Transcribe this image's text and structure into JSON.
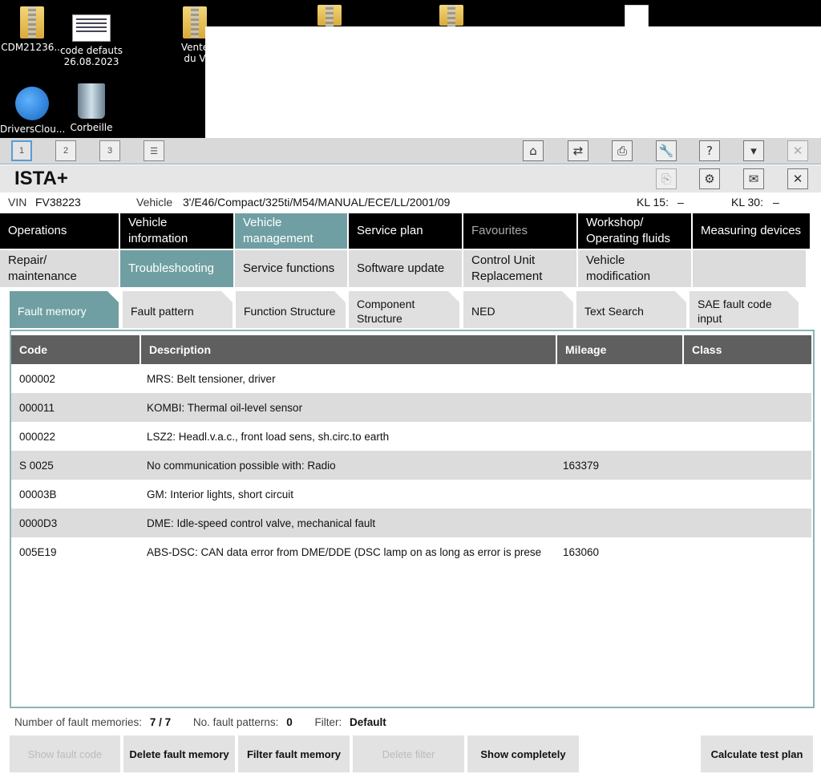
{
  "desktop": {
    "icons": [
      {
        "label": "CDM21236...",
        "icon": "zip-folder-icon"
      },
      {
        "label": "code defauts",
        "sub": "26.08.2023",
        "icon": "spreadsheet-icon"
      },
      {
        "label": "Vente",
        "sub": "du V",
        "icon": "zip-folder-icon"
      },
      {
        "label": "DriversClou...",
        "icon": "drivers-cloud-icon"
      },
      {
        "label": "Corbeille",
        "icon": "recycle-bin-icon"
      }
    ]
  },
  "toolbar": {
    "sessions": [
      "1",
      "2",
      "3"
    ],
    "icons": {
      "home": "⌂",
      "connect": "⇄",
      "print": "⎙",
      "wrench": "🔧",
      "help": "?",
      "hide": "▾",
      "close": "✕"
    }
  },
  "app": {
    "title": "ISTA+",
    "icons": {
      "doc": "⎘",
      "settings": "⚙",
      "mail": "✉",
      "close": "✕"
    }
  },
  "vehicle": {
    "vin_label": "VIN",
    "vin": "FV38223",
    "vehicle_label": "Vehicle",
    "vehicle": "3'/E46/Compact/325ti/M54/MANUAL/ECE/LL/2001/09",
    "kl15_label": "KL 15:",
    "kl15": "–",
    "kl30_label": "KL 30:",
    "kl30": "–"
  },
  "nav_main": [
    {
      "label": "Operations"
    },
    {
      "label": "Vehicle information"
    },
    {
      "label": "Vehicle management"
    },
    {
      "label": "Service plan"
    },
    {
      "label": "Favourites"
    },
    {
      "label": "Workshop/ Operating fluids"
    },
    {
      "label": "Measuring devices"
    }
  ],
  "nav_sub": [
    {
      "label": "Repair/ maintenance"
    },
    {
      "label": "Troubleshooting"
    },
    {
      "label": "Service functions"
    },
    {
      "label": "Software update"
    },
    {
      "label": "Control Unit Replacement"
    },
    {
      "label": "Vehicle modification"
    },
    {
      "label": ""
    }
  ],
  "tabs": [
    {
      "label": "Fault memory"
    },
    {
      "label": "Fault pattern"
    },
    {
      "label": "Function Structure"
    },
    {
      "label": "Component Structure"
    },
    {
      "label": "NED"
    },
    {
      "label": "Text Search"
    },
    {
      "label": "SAE fault code input"
    }
  ],
  "table": {
    "headers": [
      "Code",
      "Description",
      "Mileage",
      "Class"
    ],
    "rows": [
      {
        "code": "000002",
        "desc": "MRS: Belt tensioner, driver",
        "mileage": "",
        "class": ""
      },
      {
        "code": "000011",
        "desc": "KOMBI: Thermal oil-level sensor",
        "mileage": "",
        "class": ""
      },
      {
        "code": "000022",
        "desc": "LSZ2: Headl.v.a.c., front load sens, sh.circ.to earth",
        "mileage": "",
        "class": ""
      },
      {
        "code": "S 0025",
        "desc": "No communication possible with: Radio",
        "mileage": "163379",
        "class": ""
      },
      {
        "code": "00003B",
        "desc": "GM: Interior lights, short circuit",
        "mileage": "",
        "class": ""
      },
      {
        "code": "0000D3",
        "desc": "DME: Idle-speed control valve, mechanical fault",
        "mileage": "",
        "class": ""
      },
      {
        "code": "005E19",
        "desc": "ABS-DSC: CAN data error from DME/DDE (DSC lamp on as long as error is prese",
        "mileage": "163060",
        "class": ""
      }
    ]
  },
  "summary": {
    "faults_label": "Number of fault memories:",
    "faults": "7 / 7",
    "patterns_label": "No. fault patterns:",
    "patterns": "0",
    "filter_label": "Filter:",
    "filter": "Default"
  },
  "buttons": {
    "show_fault_code": "Show fault code",
    "delete_fault_memory": "Delete fault memory",
    "filter_fault_memory": "Filter fault memory",
    "delete_filter": "Delete filter",
    "show_completely": "Show completely",
    "calculate_test_plan": "Calculate test plan"
  }
}
